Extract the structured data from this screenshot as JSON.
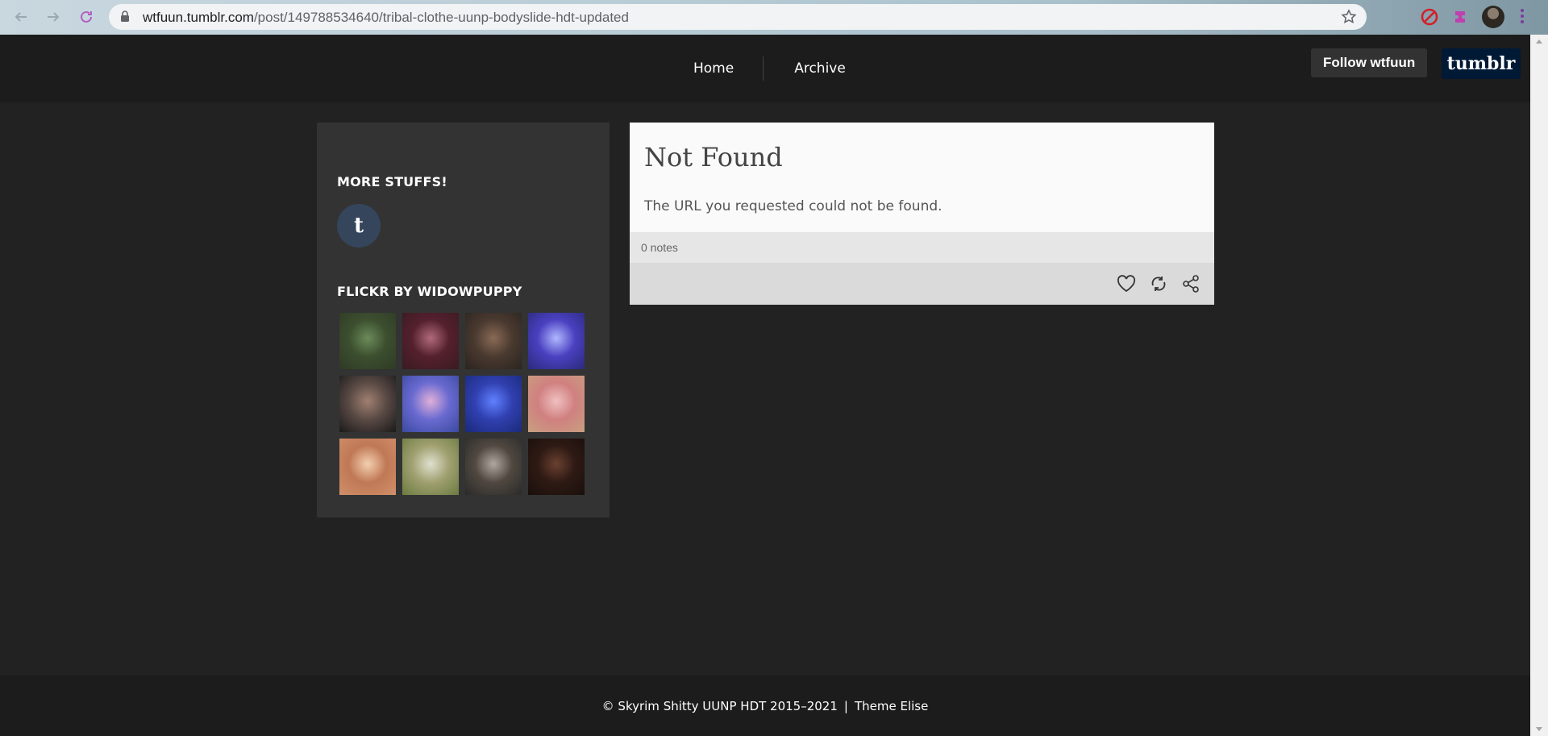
{
  "browser": {
    "url_host": "wtfuun.tumblr.com",
    "url_path": "/post/149788534640/tribal-clothe-uunp-bodyslide-hdt-updated",
    "icons": [
      "back-icon",
      "forward-icon",
      "reload-icon",
      "lock-icon",
      "bookmark-star-icon",
      "adblock-icon",
      "extensions-icon",
      "profile-avatar",
      "menu-dots-icon"
    ]
  },
  "header": {
    "nav": [
      {
        "label": "Home"
      },
      {
        "label": "Archive"
      }
    ],
    "follow_label": "Follow wtfuun",
    "logo_text": "tumblr"
  },
  "sidebar": {
    "more_heading": "MORE STUFFS!",
    "tumblr_icon_glyph": "t",
    "flickr_heading": "FLICKR BY WIDOWPUPPY",
    "thumbs": [
      {
        "colors": [
          "#2f3a25",
          "#6b8a5a",
          "#3c4f2f"
        ]
      },
      {
        "colors": [
          "#3a1b22",
          "#b06a7a",
          "#54202d"
        ]
      },
      {
        "colors": [
          "#2b2420",
          "#8a6a55",
          "#4a3a30"
        ]
      },
      {
        "colors": [
          "#2a2a7a",
          "#b0b8ff",
          "#4a40c0"
        ]
      },
      {
        "colors": [
          "#1a1a1a",
          "#a08070",
          "#5a4a45"
        ]
      },
      {
        "colors": [
          "#3a4aa0",
          "#e0b0d8",
          "#6a6ad0"
        ]
      },
      {
        "colors": [
          "#1a2a7a",
          "#6080ff",
          "#3040b0"
        ]
      },
      {
        "colors": [
          "#c8a080",
          "#f0c0c0",
          "#d08080"
        ]
      },
      {
        "colors": [
          "#d0906a",
          "#f3d0b0",
          "#c07855"
        ]
      },
      {
        "colors": [
          "#6a7a40",
          "#e0e0d0",
          "#a0a070"
        ]
      },
      {
        "colors": [
          "#2a2a2a",
          "#b0a8a0",
          "#504840"
        ]
      },
      {
        "colors": [
          "#1a0f0c",
          "#6a4030",
          "#2e1a14"
        ]
      }
    ]
  },
  "post": {
    "title": "Not Found",
    "text": "The URL you requested could not be found.",
    "notes": "0 notes"
  },
  "footer": {
    "copyright": "© Skyrim Shitty UUNP HDT 2015–2021",
    "separator": "|",
    "theme": "Theme Elise"
  }
}
